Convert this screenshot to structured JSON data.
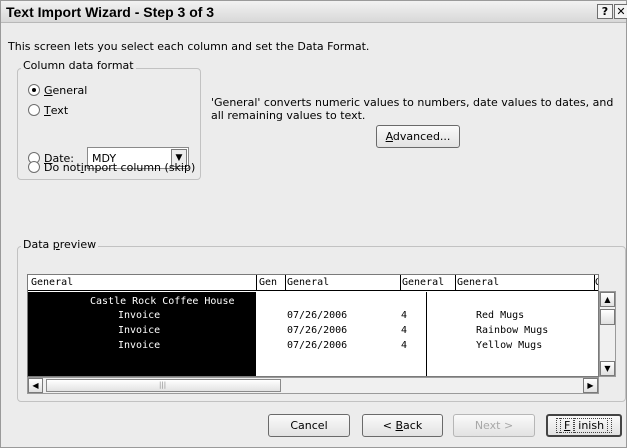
{
  "window": {
    "title": "Text Import Wizard - Step 3 of 3",
    "help_label": "?",
    "close_label": "✕"
  },
  "intro": "This screen lets you select each column and set the Data Format.",
  "column_format": {
    "legend": "Column data format",
    "options": {
      "general": {
        "mnemonic": "G",
        "rest": "eneral",
        "selected": true
      },
      "text": {
        "mnemonic": "T",
        "rest": "ext",
        "selected": false
      },
      "date": {
        "mnemonic": "D",
        "rest": "ate:",
        "selected": false
      },
      "skip": {
        "pre": "Do not ",
        "mnemonic": "i",
        "rest": "mport column (skip)",
        "selected": false
      }
    },
    "date_select": {
      "value": "MDY",
      "arrow": "▼"
    }
  },
  "description": "'General' converts numeric values to numbers, date values to dates, and all remaining values to text.",
  "advanced_button": {
    "mnemonic": "A",
    "rest": "dvanced..."
  },
  "preview": {
    "legend_mnemonic": "p",
    "legend_pre": "Data ",
    "legend_rest": "review",
    "headers": [
      "General",
      "Gen",
      "General",
      "General",
      "General",
      "G"
    ],
    "rows": [
      [
        "Castle Rock Coffee House",
        "",
        "",
        "",
        ""
      ],
      [
        "Invoice",
        "",
        "07/26/2006",
        "4",
        "Red Mugs"
      ],
      [
        "Invoice",
        "",
        "07/26/2006",
        "4",
        "Rainbow Mugs"
      ],
      [
        "Invoice",
        "",
        "07/26/2006",
        "4",
        "Yellow Mugs"
      ]
    ]
  },
  "scrollbars": {
    "up": "▲",
    "down": "▼",
    "left": "◀",
    "right": "▶",
    "grip": "|||"
  },
  "footer": {
    "cancel": "Cancel",
    "back_pre": "< ",
    "back_mnemonic": "B",
    "back_rest": "ack",
    "next": "Next >",
    "finish_mnemonic": "F",
    "finish_rest": "inish"
  }
}
